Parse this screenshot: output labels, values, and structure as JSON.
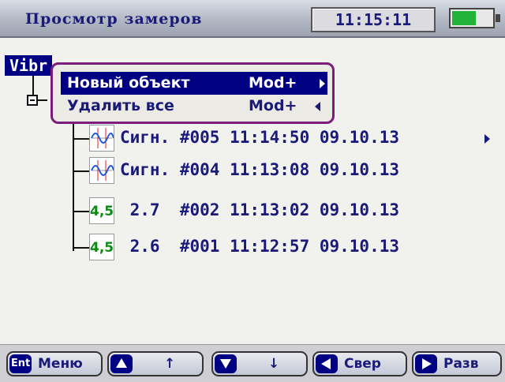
{
  "header": {
    "title": "Просмотр замеров",
    "time": "11:15:11",
    "battery_level": 0.6
  },
  "tree": {
    "root_label": "Vibr",
    "rows": [
      {
        "icon": "signal-icon",
        "text": "Сигн. #005 11:14:50 09.10.13",
        "has_more": true
      },
      {
        "icon": "signal-icon",
        "text": "Сигн. #004 11:13:08 09.10.13",
        "has_more": false
      },
      {
        "icon": "value-icon",
        "icon_text": "4,5",
        "text": " 2.7  #002 11:13:02 09.10.13",
        "has_more": false
      },
      {
        "icon": "value-icon",
        "icon_text": "4,5",
        "text": " 2.6  #001 11:12:57 09.10.13",
        "has_more": false
      }
    ]
  },
  "popup": {
    "items": [
      {
        "label": "Новый объект",
        "shortcut": "Mod+",
        "selected": true
      },
      {
        "label": "Удалить все",
        "shortcut": "Mod+",
        "selected": false
      }
    ]
  },
  "footer": {
    "ent_chip": "Ent",
    "menu": "Меню",
    "up_key": "↑",
    "down_key": "↓",
    "collapse": "Свер",
    "expand": "Разв"
  },
  "colors": {
    "accent": "#000082",
    "text": "#1a1a78",
    "popup_border": "#7b1d7a",
    "value_green": "#0b8a14"
  }
}
